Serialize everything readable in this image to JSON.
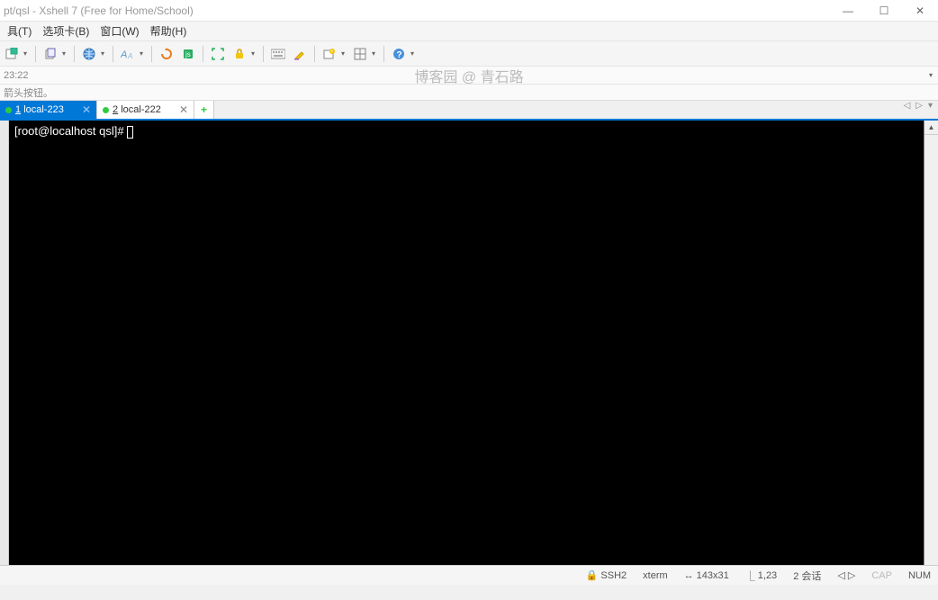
{
  "titlebar": {
    "title": "pt/qsl - Xshell 7 (Free for Home/School)"
  },
  "menubar": {
    "items": [
      "具(T)",
      "选项卡(B)",
      "窗口(W)",
      "帮助(H)"
    ]
  },
  "addressbar": {
    "text": "23:22",
    "watermark": "博客园 @ 青石路"
  },
  "hintbar": {
    "text": "箭头按钮。"
  },
  "tabs": {
    "items": [
      {
        "num": "1",
        "label": "local-223",
        "active": true
      },
      {
        "num": "2",
        "label": "local-222",
        "active": false
      }
    ]
  },
  "terminal": {
    "line1": "[root@localhost qsl]# "
  },
  "statusbar": {
    "conn": "SSH2",
    "term": "xterm",
    "size": "143x31",
    "pos": "1,23",
    "sessions": "2 会话",
    "cap": "CAP",
    "num": "NUM"
  },
  "icons": {
    "minimize": "—",
    "maximize": "☐",
    "close": "✕",
    "dropdown": "▾",
    "plus": "+",
    "arrow_left": "◁",
    "arrow_right": "▷",
    "arrow_up": "▲",
    "lock": "🔒",
    "resize": "↔",
    "ruler": "⎿"
  }
}
